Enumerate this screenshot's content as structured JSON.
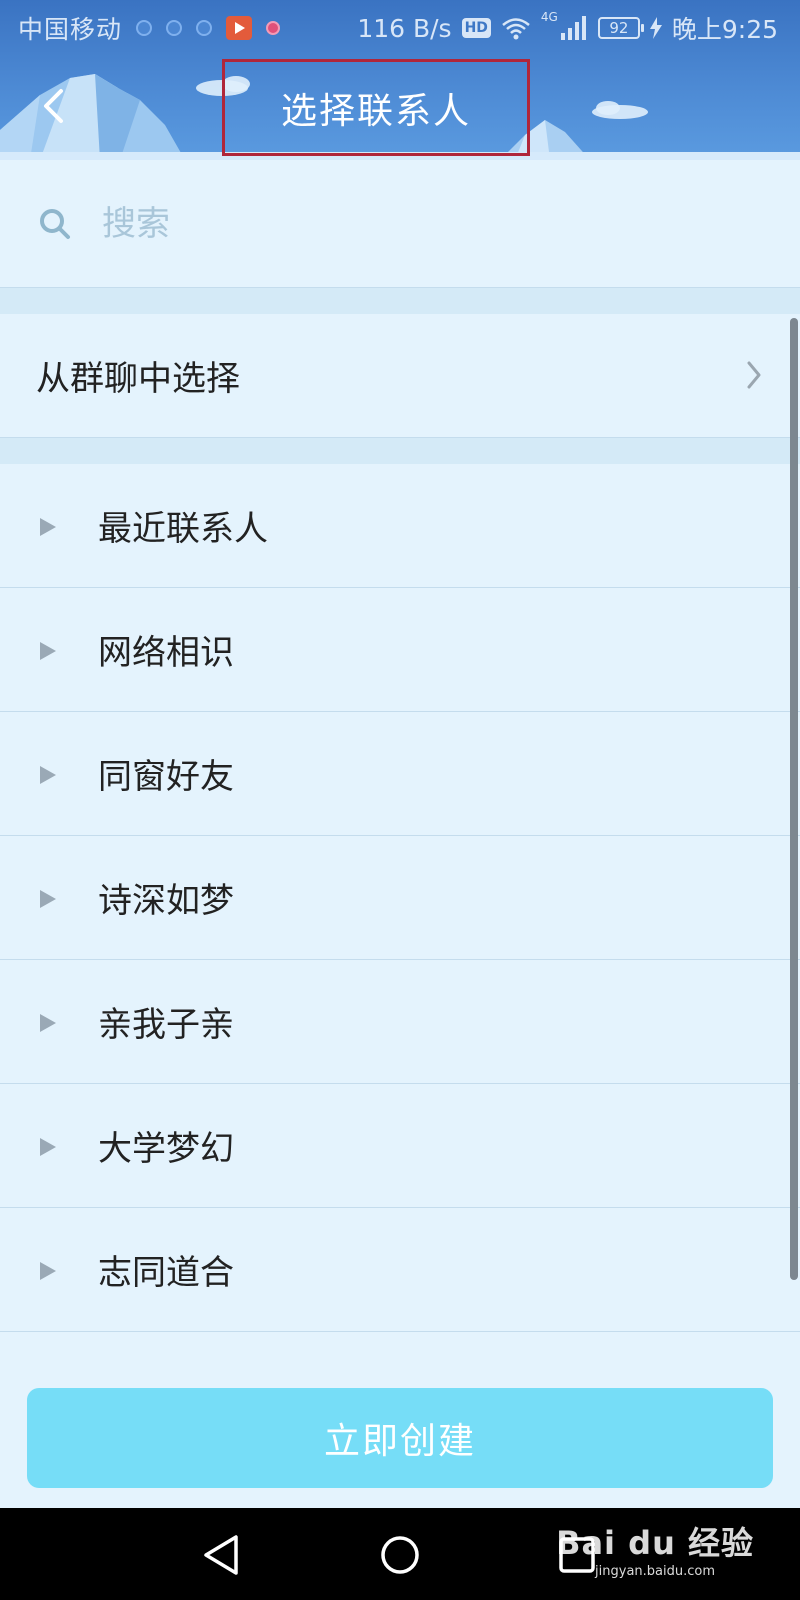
{
  "status_bar": {
    "carrier": "中国移动",
    "net_speed": "116 B/s",
    "hd_badge": "HD",
    "signal_tag": "4G",
    "battery": "92",
    "time": "晚上9:25"
  },
  "header": {
    "title": "选择联系人",
    "back_icon": "back-arrow-icon"
  },
  "search": {
    "placeholder": "搜索",
    "value": "",
    "icon": "search-icon"
  },
  "group_select": {
    "label": "从群聊中选择",
    "icon": "chevron-right-icon"
  },
  "groups": [
    {
      "label": "最近联系人"
    },
    {
      "label": "网络相识"
    },
    {
      "label": "同窗好友"
    },
    {
      "label": "诗深如梦"
    },
    {
      "label": "亲我子亲"
    },
    {
      "label": "大学梦幻"
    },
    {
      "label": "志同道合"
    }
  ],
  "create_button": {
    "label": "立即创建"
  },
  "watermark": {
    "logo": "Bai du 经验",
    "url": "jingyan.baidu.com"
  },
  "colors": {
    "header_blue": "#4d8ad4",
    "background": "#e4f3fd",
    "button_cyan": "#76ddf7",
    "highlight_red": "#b0263a"
  }
}
